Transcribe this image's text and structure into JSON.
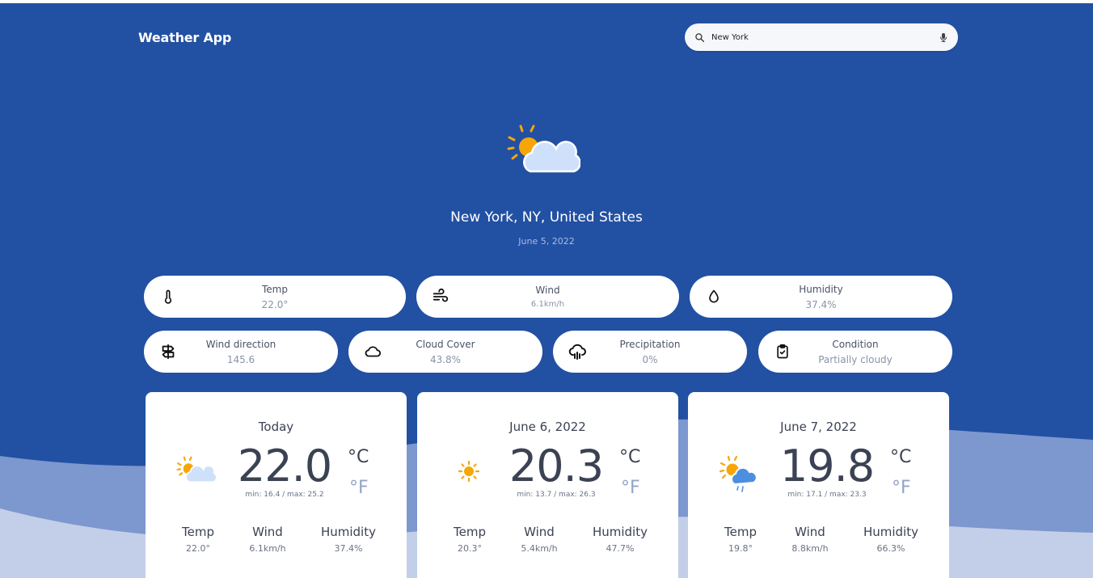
{
  "app": {
    "title": "Weather App"
  },
  "search": {
    "value": "New York",
    "icon": "search-icon",
    "mic_icon": "microphone-icon"
  },
  "current": {
    "location": "New York, NY, United States",
    "date": "June 5, 2022",
    "icon": "partly-cloudy-icon"
  },
  "metrics": {
    "temp": {
      "label": "Temp",
      "value": "22.0°",
      "icon": "thermometer-icon"
    },
    "wind": {
      "label": "Wind",
      "value": "6.1km/h",
      "icon": "wind-icon"
    },
    "humidity": {
      "label": "Humidity",
      "value": "37.4%",
      "icon": "droplet-icon"
    },
    "wind_direction": {
      "label": "Wind direction",
      "value": "145.6",
      "icon": "signpost-icon"
    },
    "cloud_cover": {
      "label": "Cloud Cover",
      "value": "43.8%",
      "icon": "cloud-icon"
    },
    "precipitation": {
      "label": "Precipitation",
      "value": "0%",
      "icon": "cloud-rain-icon"
    },
    "condition": {
      "label": "Condition",
      "value": "Partially cloudy",
      "icon": "clipboard-check-icon"
    }
  },
  "forecast": [
    {
      "title": "Today",
      "temp": "22.0",
      "minmax": "min: 16.4 / max: 25.2",
      "unit_c": "°C",
      "unit_f": "°F",
      "icon": "partly-cloudy-icon",
      "stats": {
        "temp_label": "Temp",
        "temp": "22.0°",
        "wind_label": "Wind",
        "wind": "6.1km/h",
        "humidity_label": "Humidity",
        "humidity": "37.4%"
      }
    },
    {
      "title": "June 6, 2022",
      "temp": "20.3",
      "minmax": "min: 13.7 / max: 26.3",
      "unit_c": "°C",
      "unit_f": "°F",
      "icon": "sun-icon",
      "stats": {
        "temp_label": "Temp",
        "temp": "20.3°",
        "wind_label": "Wind",
        "wind": "5.4km/h",
        "humidity_label": "Humidity",
        "humidity": "47.7%"
      }
    },
    {
      "title": "June 7, 2022",
      "temp": "19.8",
      "minmax": "min: 17.1 / max: 23.3",
      "unit_c": "°C",
      "unit_f": "°F",
      "icon": "sun-cloud-rain-icon",
      "stats": {
        "temp_label": "Temp",
        "temp": "19.8°",
        "wind_label": "Wind",
        "wind": "8.8km/h",
        "humidity_label": "Humidity",
        "humidity": "66.3%"
      }
    }
  ],
  "colors": {
    "background": "#2250a3",
    "wave_mid": "#7d97cf",
    "wave_light": "#c3cfe8",
    "sun": "#f6a609",
    "cloud": "#cfe0fb",
    "rain_cloud": "#4c8fe0"
  }
}
